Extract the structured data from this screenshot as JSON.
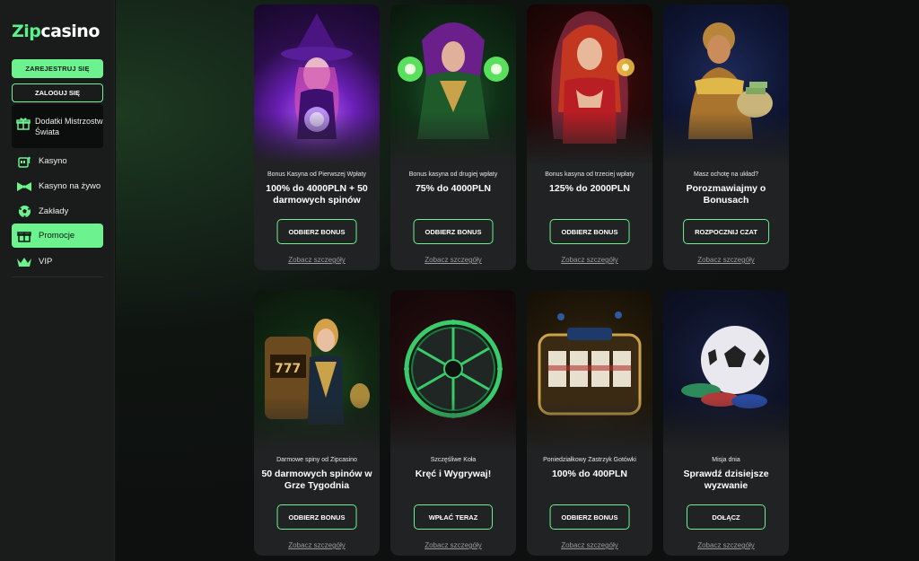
{
  "brand": {
    "logo_zip": "Zip",
    "logo_casino": "casino",
    "accent": "#6cf28f"
  },
  "sidebar": {
    "register_label": "ZAREJESTRUJ SIĘ",
    "login_label": "ZALOGUJ SIĘ",
    "promo_label": "Dodatki Mistrzostw Świata",
    "items": [
      {
        "label": "Kasyno",
        "icon": "slot-machine-icon"
      },
      {
        "label": "Kasyno na żywo",
        "icon": "bow-tie-icon"
      },
      {
        "label": "Zakłady",
        "icon": "soccer-ball-icon"
      },
      {
        "label": "Promocje",
        "icon": "gift-icon",
        "active": true
      },
      {
        "label": "VIP",
        "icon": "crown-icon"
      }
    ]
  },
  "cards": [
    {
      "subtitle": "Bonus Kasyna od Pierwszej Wpłaty",
      "title": "100% do 4000PLN + 50 darmowych spinów",
      "cta": "ODBIERZ BONUS",
      "details": "Zobacz szczegóły",
      "art": "purple-witch"
    },
    {
      "subtitle": "Bonus kasyna od drugiej wpłaty",
      "title": "75% do 4000PLN",
      "cta": "ODBIERZ BONUS",
      "details": "Zobacz szczegóły",
      "art": "green-sorceress"
    },
    {
      "subtitle": "Bonus kasyna od trzeciej wpłaty",
      "title": "125% do 2000PLN",
      "cta": "ODBIERZ BONUS",
      "details": "Zobacz szczegóły",
      "art": "fire-woman"
    },
    {
      "subtitle": "Masz ochotę na układ?",
      "title": "Porozmawiajmy o Bonusach",
      "cta": "ROZPOCZNIJ CZAT",
      "details": "Zobacz szczegóły",
      "art": "golden-man"
    },
    {
      "subtitle": "Darmowe spiny od Zipcasino",
      "title": "50 darmowych spinów w Grze Tygodnia",
      "cta": "ODBIERZ BONUS",
      "details": "Zobacz szczegóły",
      "art": "slot-goddess"
    },
    {
      "subtitle": "Szczęśliwe Koła",
      "title": "Kręć i Wygrywaj!",
      "cta": "WPŁAĆ TERAZ",
      "details": "Zobacz szczegóły",
      "art": "wheel"
    },
    {
      "subtitle": "Poniedziałkowy Zastrzyk Gotówki",
      "title": "100% do 400PLN",
      "cta": "ODBIERZ BONUS",
      "details": "Zobacz szczegóły",
      "art": "slot-machine"
    },
    {
      "subtitle": "Misja dnia",
      "title": "Sprawdź dzisiejsze wyzwanie",
      "cta": "DOŁĄCZ",
      "details": "Zobacz szczegóły",
      "art": "football"
    }
  ]
}
